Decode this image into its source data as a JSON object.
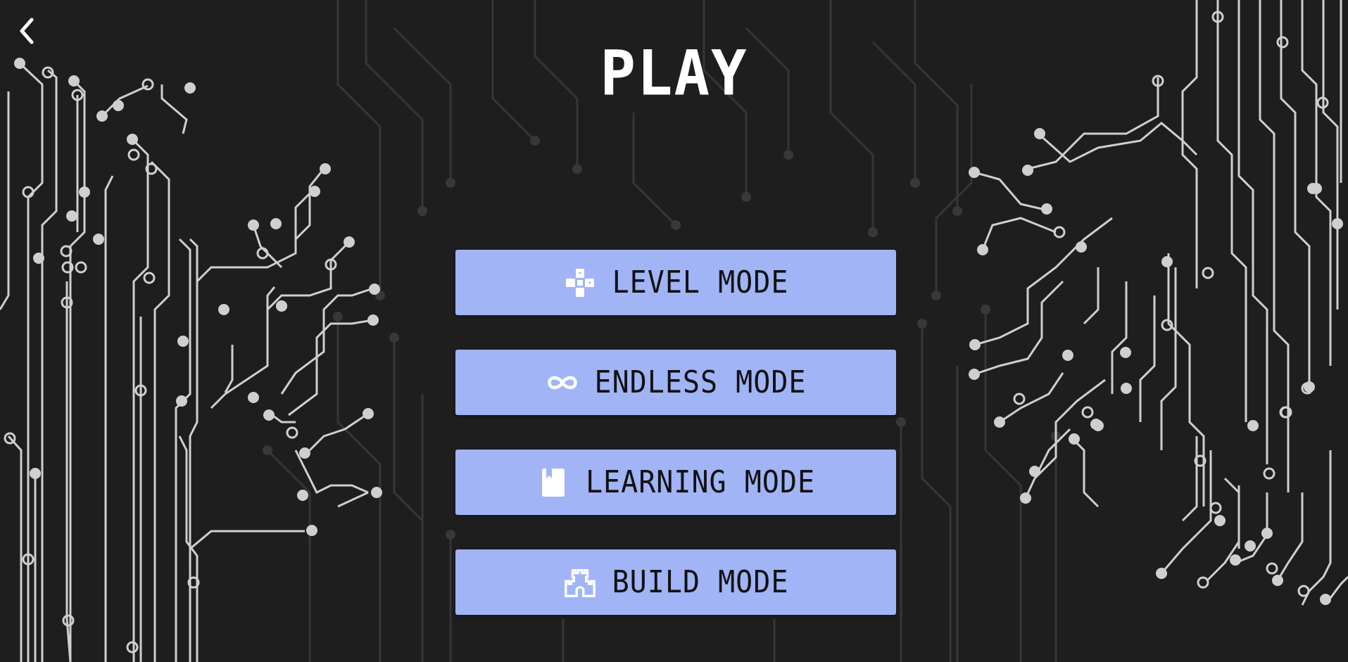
{
  "screen": {
    "title": "PLAY",
    "back_icon": "chevron-left-icon"
  },
  "menu": {
    "buttons": [
      {
        "id": "level",
        "label": "LEVEL MODE",
        "icon": "gamepad-icon"
      },
      {
        "id": "endless",
        "label": "ENDLESS MODE",
        "icon": "infinity-icon"
      },
      {
        "id": "learning",
        "label": "LEARNING MODE",
        "icon": "book-icon"
      },
      {
        "id": "build",
        "label": "BUILD MODE",
        "icon": "castle-icon"
      }
    ]
  },
  "colors": {
    "background": "#1e1e1e",
    "button": "#a0b4f6",
    "button_text": "#111111",
    "title": "#ffffff",
    "circuit_bright": "#d0d0d0",
    "circuit_dim": "#3a3a3a"
  }
}
